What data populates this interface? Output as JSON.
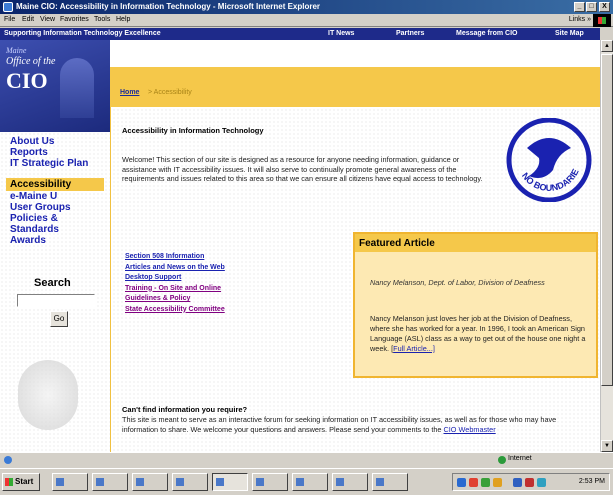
{
  "window": {
    "title": "Maine CIO: Accessibility in Information Technology - Microsoft Internet Explorer",
    "min": "_",
    "max": "□",
    "close": "X"
  },
  "menu": {
    "items": [
      "File",
      "Edit",
      "View",
      "Favorites",
      "Tools",
      "Help"
    ],
    "links": "Links »"
  },
  "sitebar": {
    "tagline": "Supporting Information Technology Excellence",
    "nav": [
      "IT News",
      "Partners",
      "Message from CIO",
      "Site Map"
    ]
  },
  "logo": {
    "line1": "Maine",
    "line2": "Office of the",
    "line3": "CIO"
  },
  "breadcrumb": {
    "home": "Home",
    "sep": "> Accessibility"
  },
  "sidebar": {
    "items": [
      "About Us",
      "Reports",
      "IT Strategic Plan",
      "Accessibility",
      "e-Maine U",
      "User Groups",
      "Policies &",
      "Standards",
      "Awards"
    ]
  },
  "search": {
    "label": "Search",
    "go": "Go"
  },
  "main": {
    "heading": "Accessibility in Information Technology",
    "intro": "Welcome! This section of our site is designed as a resource for anyone needing information, guidance or assistance with IT accessibility issues. It will also serve to continually promote general awareness of the requirements and issues related to this area so that we can ensure all citizens have equal access to technology.",
    "links": [
      "Section 508 Information",
      "Articles and News on the Web",
      "Desktop Support",
      "Training - On Site and Online",
      "Guidelines & Policy",
      "State Accessibility Committee"
    ]
  },
  "badge": {
    "text": "NO BOUNDARIES"
  },
  "featured": {
    "title": "Featured Article",
    "author": "Nancy Melanson, Dept. of Labor, Division of Deafness",
    "body": "Nancy Melanson just loves her job at the Division of Deafness, where she has worked for a year. In 1996, I took an American Sign Language (ASL) class as a way to get out of the house one night a week.",
    "link": "Full Article...]"
  },
  "question": {
    "heading": "Can't find information you require?",
    "body": "This site is meant to serve as an interactive forum for seeking information on IT accessibility issues, as well as for those who may have information to share. We welcome your questions and answers. Please send your comments to the ",
    "link": "CIO Webmaster"
  },
  "status": {
    "left": "",
    "zone": "Internet"
  },
  "taskbar": {
    "start": "Start",
    "items": [
      "",
      "",
      "",
      "",
      "",
      "",
      "",
      "",
      ""
    ],
    "clock": "2:53 PM"
  },
  "colors": {
    "accent": "#f5c84a",
    "nav": "#1a22b0",
    "sitebar": "#1e2a8a"
  }
}
